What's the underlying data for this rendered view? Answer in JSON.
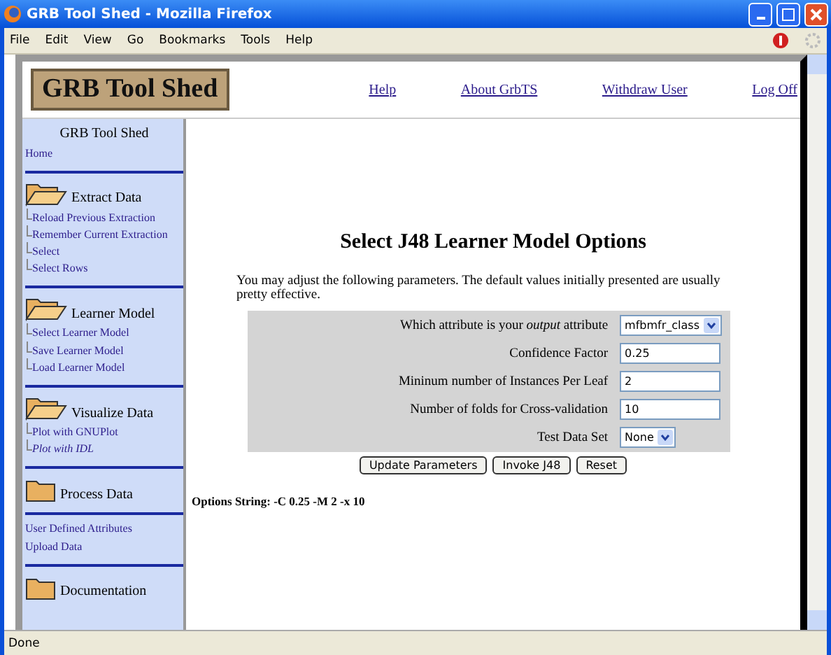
{
  "window": {
    "title": "GRB Tool Shed - Mozilla Firefox"
  },
  "menu": [
    "File",
    "Edit",
    "View",
    "Go",
    "Bookmarks",
    "Tools",
    "Help"
  ],
  "header": {
    "logo": "GRB Tool Shed",
    "links": [
      "Help",
      "About GrbTS",
      "Withdraw User",
      "Log Off"
    ]
  },
  "sidebar": [
    {
      "kind": "title",
      "title": "GRB Tool Shed",
      "items": [
        {
          "label": "Home",
          "italic": false
        }
      ]
    },
    {
      "kind": "open",
      "title": "Extract Data",
      "items": [
        {
          "label": "Reload Previous Extraction",
          "italic": false
        },
        {
          "label": "Remember Current Extraction",
          "italic": false
        },
        {
          "label": "Select",
          "italic": false
        },
        {
          "label": "Select Rows",
          "italic": false
        }
      ]
    },
    {
      "kind": "open",
      "title": "Learner Model",
      "items": [
        {
          "label": "Select Learner Model",
          "italic": false
        },
        {
          "label": "Save Learner Model",
          "italic": false
        },
        {
          "label": "Load Learner Model",
          "italic": false
        }
      ]
    },
    {
      "kind": "open",
      "title": "Visualize Data",
      "items": [
        {
          "label": "Plot with GNUPlot",
          "italic": false
        },
        {
          "label": "Plot with IDL",
          "italic": true
        }
      ]
    },
    {
      "kind": "closed",
      "title": "Process Data"
    },
    {
      "kind": "links",
      "items": [
        {
          "label": "User Defined Attributes",
          "italic": false
        },
        {
          "label": "Upload Data",
          "italic": false
        }
      ]
    },
    {
      "kind": "closed",
      "title": "Documentation"
    }
  ],
  "main": {
    "heading": "Select J48 Learner Model Options",
    "intro": "You may adjust the following parameters.  The default values initially presented are usually pretty effective.",
    "form": [
      {
        "kind": "select",
        "label": "Which attribute is your *output* attribute",
        "value": "mfbmfr_class"
      },
      {
        "kind": "text",
        "label": "Confidence Factor",
        "value": "0.25"
      },
      {
        "kind": "text",
        "label": "Mininum number of Instances Per Leaf",
        "value": "2"
      },
      {
        "kind": "text",
        "label": "Number of folds for Cross-validation",
        "value": "10"
      },
      {
        "kind": "select",
        "label": "Test Data Set",
        "value": "None"
      }
    ],
    "buttons": [
      "Update Parameters",
      "Invoke J48",
      "Reset"
    ],
    "options_string": "Options String: -C 0.25 -M 2 -x 10"
  },
  "status_bar": "Done"
}
